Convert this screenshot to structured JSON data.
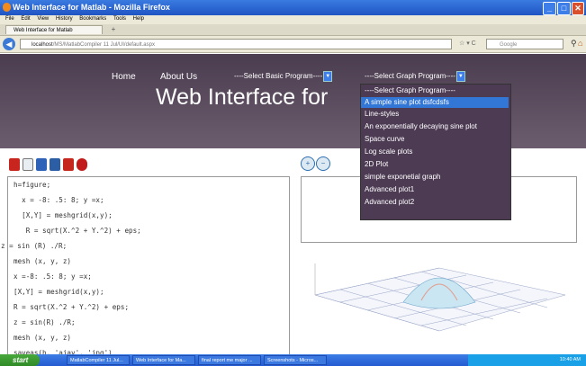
{
  "window": {
    "title": "Web Interface for Matlab - Mozilla Firefox",
    "min": "_",
    "max": "□",
    "close": "✕"
  },
  "menubar": [
    "File",
    "Edit",
    "View",
    "History",
    "Bookmarks",
    "Tools",
    "Help"
  ],
  "tab": {
    "label": "Web Interface for Matlab",
    "add": "+"
  },
  "nav": {
    "back": "◀",
    "url_host": "localhost",
    "url_path": "/MS/MatlabCompiler 11 Jul/UI/default.aspx",
    "arrows": "☆ ▾ C",
    "search_placeholder": "Google",
    "search_icon": "⚲",
    "home_icon": "⌂"
  },
  "header": {
    "home": "Home",
    "about": "About Us",
    "basic_select": "----Select Basic Program----",
    "graph_select": "----Select Graph Program----",
    "title": "Web Interface for"
  },
  "dropdown": {
    "options": [
      "----Select Graph Program----",
      "A simple sine plot dsfcdsfs",
      "Line-styles",
      "An exponentially decaying sine plot",
      "Space curve",
      "Log scale plots",
      "2D Plot",
      "simple exponetial graph",
      "Advanced plot1",
      "Advanced plot2"
    ],
    "selected_index": 1
  },
  "toolbar": {
    "icons": [
      "save-red-icon",
      "refresh-icon",
      "floppy-icon",
      "print-icon",
      "folder-red-icon",
      "stop-icon"
    ],
    "zoom_in": "+",
    "zoom_out": "−"
  },
  "code": [
    "h=figure;",
    "  x = -8: .5: 8; y =x;",
    "  [X,Y] = meshgrid(x,y);",
    "   R = sqrt(X.^2 + Y.^2) + eps;",
    "z = sin (R) ./R;",
    "mesh (x, y, z)",
    "x =-8: .5: 8; y =x;",
    "[X,Y] = meshgrid(x,y);",
    "R = sqrt(X.^2 + Y.^2) + eps;",
    "z = sin(R) ./R;",
    "mesh (x, y, z)",
    "saveas(h, 'ajay', 'jpg')"
  ],
  "taskbar": {
    "start": "start",
    "tasks": [
      "MatlabCompiler 11 Jul...",
      "Web Interface for Ma...",
      "final report me major ...",
      "Screenshots - Micros..."
    ],
    "clock": "10:40 AM"
  },
  "colors": {
    "header": "#4a3d4f",
    "dropdown_bg": "#4c3b53",
    "dropdown_selected": "#3276d6",
    "titlebar": "#2a63d0"
  }
}
